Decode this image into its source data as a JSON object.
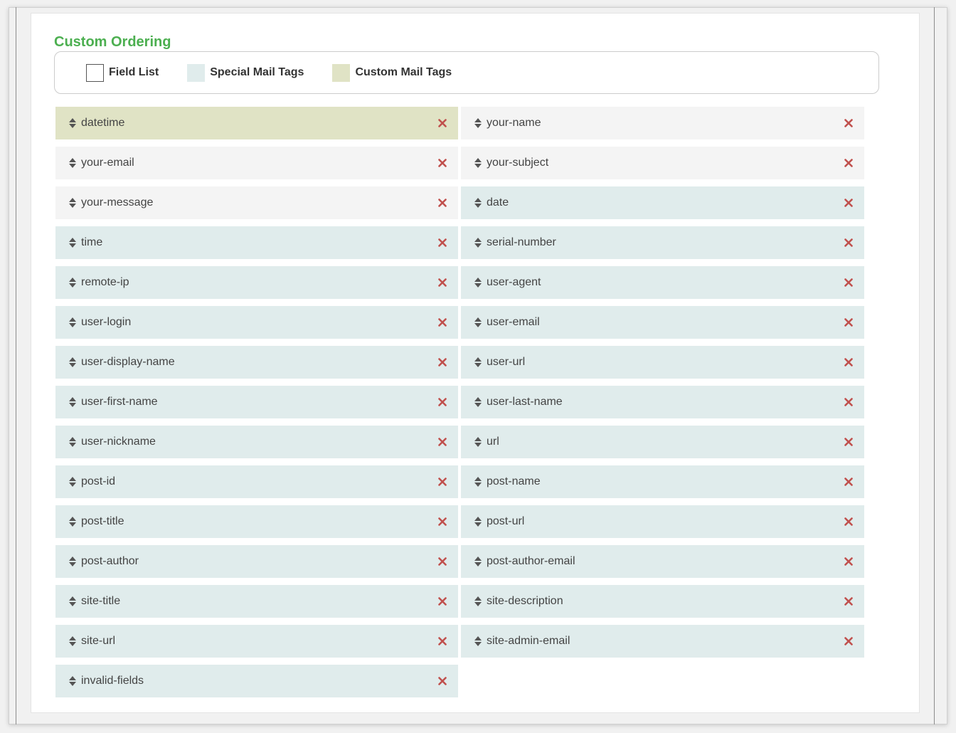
{
  "section": {
    "title": "Custom Ordering"
  },
  "legend": [
    {
      "label": "Field List",
      "kind": "field"
    },
    {
      "label": "Special Mail Tags",
      "kind": "special"
    },
    {
      "label": "Custom Mail Tags",
      "kind": "custom"
    }
  ],
  "colors": {
    "title_green": "#4caf50",
    "field_bg": "#f4f4f4",
    "special_bg": "#e0ecec",
    "custom_bg": "#e0e3c5",
    "remove_red": "#c0504d"
  },
  "icons": {
    "drag": "sort-icon",
    "remove": "remove-x-icon"
  },
  "tags": [
    {
      "label": "datetime",
      "kind": "custom"
    },
    {
      "label": "your-name",
      "kind": "field"
    },
    {
      "label": "your-email",
      "kind": "field"
    },
    {
      "label": "your-subject",
      "kind": "field"
    },
    {
      "label": "your-message",
      "kind": "field"
    },
    {
      "label": "date",
      "kind": "special"
    },
    {
      "label": "time",
      "kind": "special"
    },
    {
      "label": "serial-number",
      "kind": "special"
    },
    {
      "label": "remote-ip",
      "kind": "special"
    },
    {
      "label": "user-agent",
      "kind": "special"
    },
    {
      "label": "user-login",
      "kind": "special"
    },
    {
      "label": "user-email",
      "kind": "special"
    },
    {
      "label": "user-display-name",
      "kind": "special"
    },
    {
      "label": "user-url",
      "kind": "special"
    },
    {
      "label": "user-first-name",
      "kind": "special"
    },
    {
      "label": "user-last-name",
      "kind": "special"
    },
    {
      "label": "user-nickname",
      "kind": "special"
    },
    {
      "label": "url",
      "kind": "special"
    },
    {
      "label": "post-id",
      "kind": "special"
    },
    {
      "label": "post-name",
      "kind": "special"
    },
    {
      "label": "post-title",
      "kind": "special"
    },
    {
      "label": "post-url",
      "kind": "special"
    },
    {
      "label": "post-author",
      "kind": "special"
    },
    {
      "label": "post-author-email",
      "kind": "special"
    },
    {
      "label": "site-title",
      "kind": "special"
    },
    {
      "label": "site-description",
      "kind": "special"
    },
    {
      "label": "site-url",
      "kind": "special"
    },
    {
      "label": "site-admin-email",
      "kind": "special"
    },
    {
      "label": "invalid-fields",
      "kind": "special"
    }
  ]
}
